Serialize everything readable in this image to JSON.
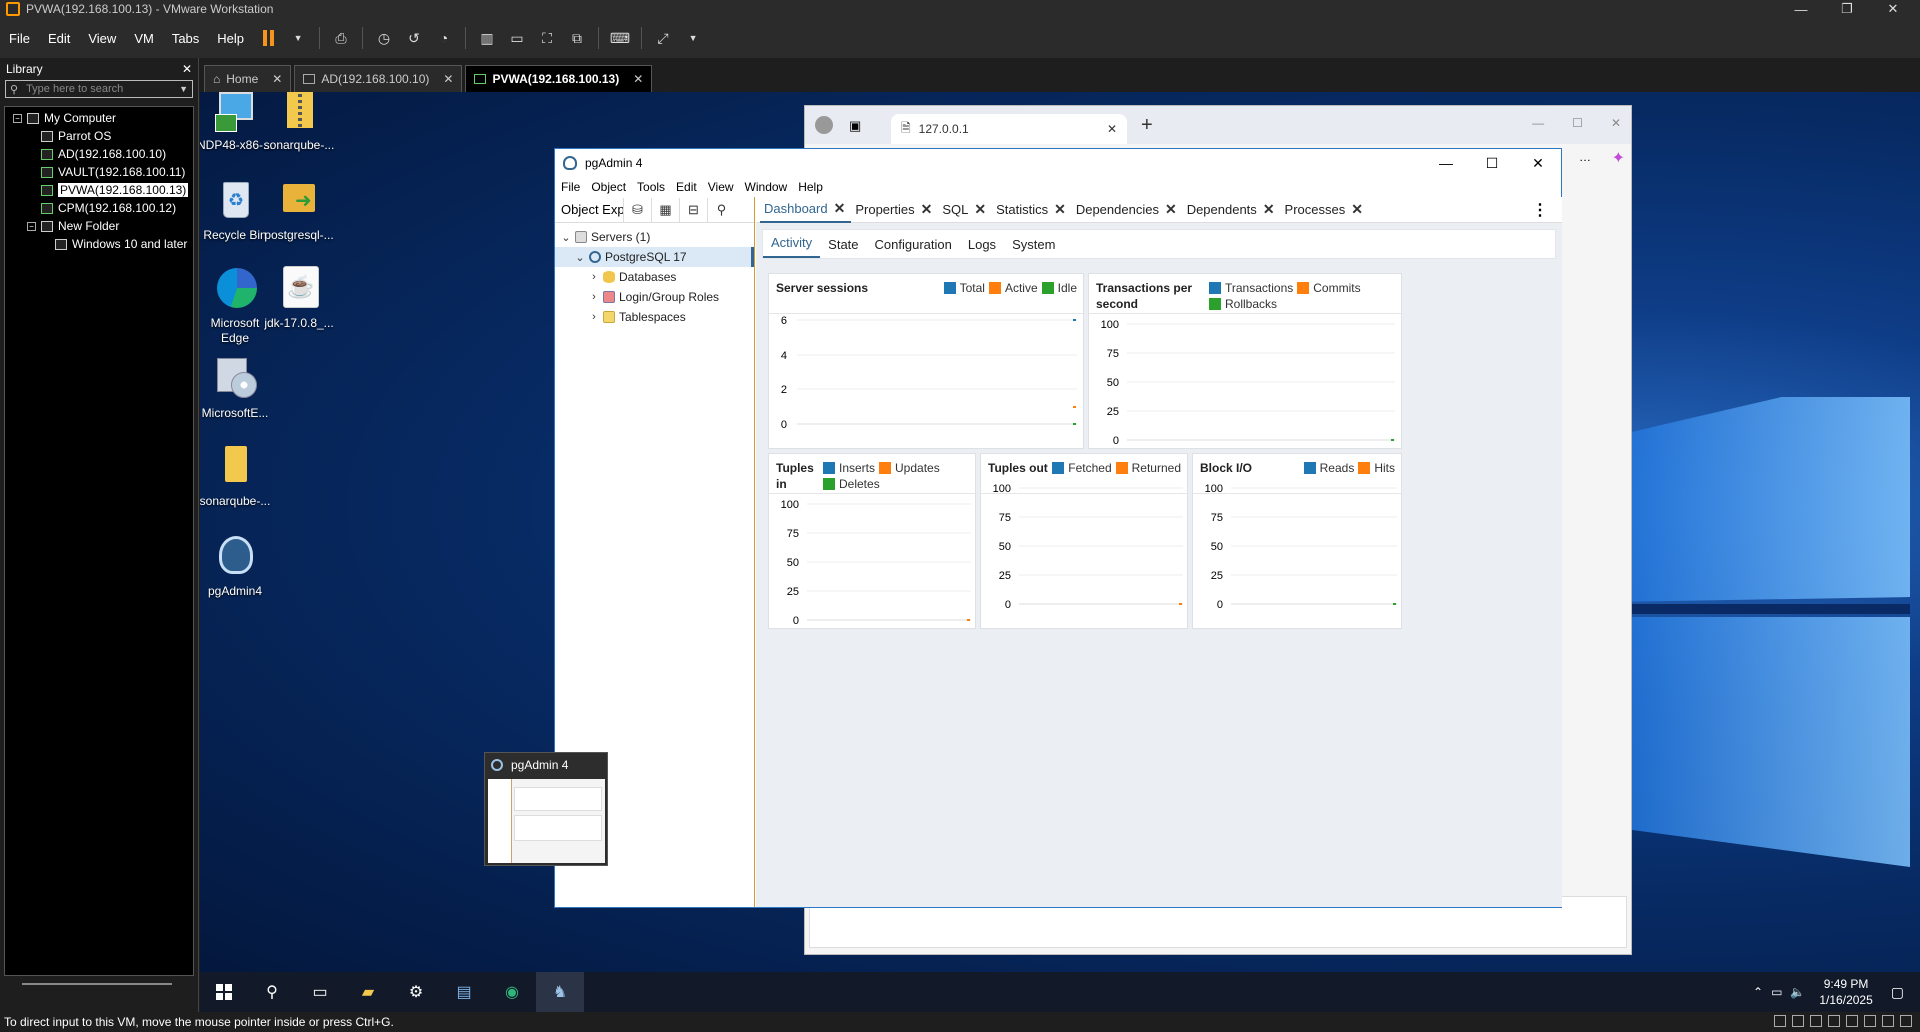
{
  "vmware": {
    "title": "PVWA(192.168.100.13) - VMware Workstation",
    "menu": [
      "File",
      "Edit",
      "View",
      "VM",
      "Tabs",
      "Help"
    ],
    "library": {
      "title": "Library",
      "search_placeholder": "Type here to search",
      "tree": [
        {
          "label": "My Computer",
          "level": 0
        },
        {
          "label": "Parrot OS",
          "level": 1
        },
        {
          "label": "AD(192.168.100.10)",
          "level": 1
        },
        {
          "label": "VAULT(192.168.100.11)",
          "level": 1
        },
        {
          "label": "PVWA(192.168.100.13)",
          "level": 1,
          "selected": true
        },
        {
          "label": "CPM(192.168.100.12)",
          "level": 1
        },
        {
          "label": "New Folder",
          "level": 1
        },
        {
          "label": "Windows 10 and later",
          "level": 2
        }
      ]
    },
    "tabs": [
      {
        "label": "Home"
      },
      {
        "label": "AD(192.168.100.10)"
      },
      {
        "label": "PVWA(192.168.100.13)",
        "active": true
      }
    ],
    "status": "To direct input to this VM, move the mouse pointer inside or press Ctrl+G."
  },
  "desktop": {
    "icons": [
      {
        "label": "NDP48-x86-..."
      },
      {
        "label": "sonarqube-..."
      },
      {
        "label": "Recycle Bin"
      },
      {
        "label": "postgresql-..."
      },
      {
        "label": "Microsoft Edge"
      },
      {
        "label": "jdk-17.0.8_..."
      },
      {
        "label": "MicrosoftE..."
      },
      {
        "label": "sonarqube-..."
      },
      {
        "label": "pgAdmin4"
      }
    ]
  },
  "browser": {
    "tab_title": "127.0.0.1"
  },
  "pgadmin": {
    "title": "pgAdmin 4",
    "menu": [
      "File",
      "Object",
      "Tools",
      "Edit",
      "View",
      "Window",
      "Help"
    ],
    "object_explorer": {
      "title": "Object Explorer",
      "tree": [
        {
          "label": "Servers (1)"
        },
        {
          "label": "PostgreSQL 17"
        },
        {
          "label": "Databases"
        },
        {
          "label": "Login/Group Roles"
        },
        {
          "label": "Tablespaces"
        }
      ]
    },
    "main_tabs": [
      "Dashboard",
      "Properties",
      "SQL",
      "Statistics",
      "Dependencies",
      "Dependents",
      "Processes"
    ],
    "sub_tabs": [
      "Activity",
      "State",
      "Configuration",
      "Logs",
      "System"
    ],
    "colors": {
      "blue": "#1f77b4",
      "orange": "#ff7f0e",
      "green": "#2ca02c"
    },
    "cards": {
      "server_sessions": {
        "title": "Server sessions",
        "legend": [
          "Total",
          "Active",
          "Idle"
        ],
        "ticks": [
          "6",
          "4",
          "2",
          "0"
        ]
      },
      "transactions": {
        "title": "Transactions per second",
        "legend": [
          "Transactions",
          "Commits",
          "Rollbacks"
        ],
        "ticks": [
          "100",
          "75",
          "50",
          "25",
          "0"
        ]
      },
      "tuples_in": {
        "title": "Tuples in",
        "legend": [
          "Inserts",
          "Updates",
          "Deletes"
        ],
        "ticks": [
          "100",
          "75",
          "50",
          "25",
          "0"
        ]
      },
      "tuples_out": {
        "title": "Tuples out",
        "legend": [
          "Fetched",
          "Returned"
        ],
        "ticks": [
          "100",
          "75",
          "50",
          "25",
          "0"
        ]
      },
      "block_io": {
        "title": "Block I/O",
        "legend": [
          "Reads",
          "Hits"
        ],
        "ticks": [
          "100",
          "75",
          "50",
          "25",
          "0"
        ]
      }
    }
  },
  "thumbnail": {
    "title": "pgAdmin 4"
  },
  "taskbar": {
    "time": "9:49 PM",
    "date": "1/16/2025"
  }
}
